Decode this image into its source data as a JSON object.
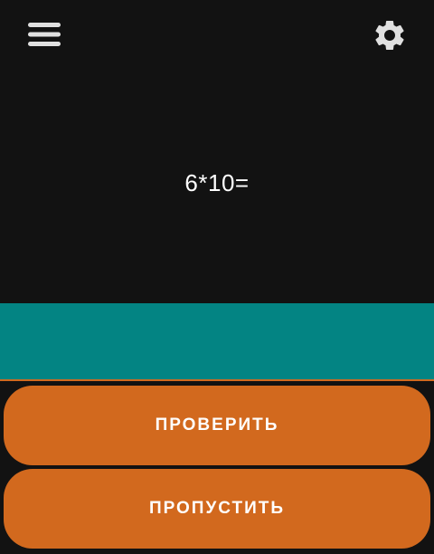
{
  "header": {
    "menu_icon": "hamburger-menu-icon",
    "settings_icon": "gear-icon"
  },
  "question": {
    "text": "6*10="
  },
  "answer": {
    "value": "",
    "placeholder": ""
  },
  "actions": {
    "check_label": "ПРОВЕРИТЬ",
    "skip_label": "ПРОПУСТИТЬ"
  },
  "colors": {
    "background": "#121212",
    "answer_field": "#038483",
    "button": "#d2691e",
    "text": "#ffffff"
  }
}
